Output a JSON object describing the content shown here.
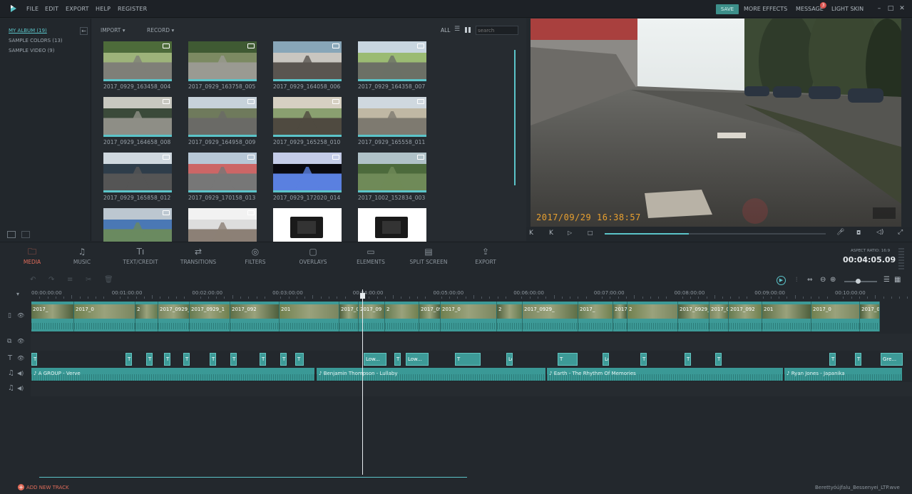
{
  "menu": {
    "items": [
      "FILE",
      "EDIT",
      "EXPORT",
      "HELP",
      "REGISTER"
    ]
  },
  "topright": {
    "save": "SAVE",
    "more_effects": "MORE EFFECTS",
    "message": "MESSAGE",
    "message_count": "3",
    "light_skin": "LIGHT SKIN"
  },
  "album": {
    "items": [
      {
        "label": "MY ALBUM (19)",
        "active": true
      },
      {
        "label": "SAMPLE COLORS (13)",
        "active": false
      },
      {
        "label": "SAMPLE VIDEO (9)",
        "active": false
      }
    ]
  },
  "media_header": {
    "import": "IMPORT",
    "record": "RECORD",
    "all": "ALL",
    "search_placeholder": "search"
  },
  "media": {
    "items": [
      {
        "label": "2017_0929_163458_004",
        "icon": "video-camera-icon"
      },
      {
        "label": "2017_0929_163758_005",
        "icon": "video-camera-icon"
      },
      {
        "label": "2017_0929_164058_006",
        "icon": "video-camera-icon"
      },
      {
        "label": "2017_0929_164358_007",
        "icon": "video-camera-icon"
      },
      {
        "label": "2017_0929_164658_008",
        "icon": "video-camera-icon"
      },
      {
        "label": "2017_0929_164958_009",
        "icon": "video-camera-icon"
      },
      {
        "label": "2017_0929_165258_010",
        "icon": "video-camera-icon"
      },
      {
        "label": "2017_0929_165558_011",
        "icon": "video-camera-icon"
      },
      {
        "label": "2017_0929_165858_012",
        "icon": "video-camera-icon"
      },
      {
        "label": "2017_0929_170158_013",
        "icon": "video-camera-icon"
      },
      {
        "label": "2017_0929_172020_014",
        "icon": "video-camera-icon"
      },
      {
        "label": "2017_1002_152834_003",
        "icon": "video-camera-icon"
      },
      {
        "label": "",
        "icon": "video-camera-icon"
      },
      {
        "label": "",
        "icon": "video-camera-icon"
      },
      {
        "label": "",
        "icon": ""
      },
      {
        "label": "",
        "icon": ""
      }
    ]
  },
  "preview": {
    "timestamp": "2017/09/29 16:38:57",
    "progress_fraction": 0.38
  },
  "toolbar": {
    "items": [
      {
        "label": "MEDIA",
        "icon": "folder-icon",
        "active": true
      },
      {
        "label": "MUSIC",
        "icon": "music-note-icon",
        "active": false
      },
      {
        "label": "TEXT/CREDIT",
        "icon": "text-icon",
        "active": false
      },
      {
        "label": "TRANSITIONS",
        "icon": "transitions-icon",
        "active": false
      },
      {
        "label": "FILTERS",
        "icon": "filters-icon",
        "active": false
      },
      {
        "label": "OVERLAYS",
        "icon": "overlays-icon",
        "active": false
      },
      {
        "label": "ELEMENTS",
        "icon": "image-icon",
        "active": false
      },
      {
        "label": "SPLIT SCREEN",
        "icon": "split-screen-icon",
        "active": false
      },
      {
        "label": "EXPORT",
        "icon": "export-icon",
        "active": false
      }
    ]
  },
  "aspect": {
    "label": "ASPECT RATIO: 16:9",
    "duration": "00:04:05.09"
  },
  "ruler": {
    "ticks": [
      "00:00:00:00",
      "00:01:00:00",
      "00:02:00:00",
      "00:03:00:00",
      "00:04:00:00",
      "00:05:00:00",
      "00:06:00:00",
      "00:07:00:00",
      "00:08:00:00",
      "00:09:00:00",
      "00:10:00:00"
    ]
  },
  "video_track": {
    "clips": [
      "2017_",
      "2017_0",
      "2",
      "2017_0929_",
      "2017_0929_1",
      "2017_092",
      "201",
      "2017_0",
      "2017_09",
      "2",
      "2017_0929_16",
      "2017_0",
      "2",
      "2017_0929_"
    ]
  },
  "text_track": {
    "items": [
      "T",
      "T",
      "T",
      "T",
      "T",
      "T",
      "T",
      "T",
      "T",
      "T",
      "Low...",
      "T",
      "Low...",
      "T",
      "Lowe...",
      "T",
      "Lo...",
      "T",
      "T",
      "T",
      "T",
      "T",
      "Gre..."
    ]
  },
  "audio_track": {
    "clips": [
      {
        "label": "A GROUP - Verve"
      },
      {
        "label": "Benjamin Thompson - Lullaby"
      },
      {
        "label": "Earth - The Rhythm Of Memories"
      },
      {
        "label": "Ryan Jones - Japanika"
      }
    ]
  },
  "footer": {
    "add_track": "ADD NEW TRACK",
    "filename": "Berettyóújfalu_Bessenyei_LTP.wve"
  },
  "colors": {
    "accent": "#5bc4c9",
    "active": "#e06c5a",
    "save": "#3d8f8a",
    "clip": "#3d9a97"
  }
}
